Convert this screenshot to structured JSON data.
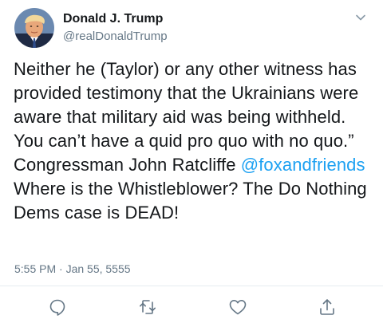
{
  "author": {
    "display_name": "Donald J. Trump",
    "handle": "@realDonaldTrump",
    "avatar_icon": "user-avatar-icon"
  },
  "tweet": {
    "text_part1": "Neither he (Taylor) or any other witness has provided testimony that the Ukrainians were aware that military aid was being withheld. You can’t have a quid pro quo with no quo.” Congressman John Ratcliffe ",
    "mention": "@foxandfriends",
    "text_part2": " Where is the Whistleblower? The Do Nothing Dems case is DEAD!",
    "timestamp": "5:55 PM · Jan 55, 5555"
  },
  "actions": {
    "reply_icon": "reply-icon",
    "retweet_icon": "retweet-icon",
    "like_icon": "heart-icon",
    "share_icon": "share-icon",
    "more_icon": "chevron-down-icon"
  },
  "colors": {
    "text": "#14171a",
    "secondary": "#657786",
    "link": "#1da1f2",
    "divider": "#e6ecf0"
  }
}
